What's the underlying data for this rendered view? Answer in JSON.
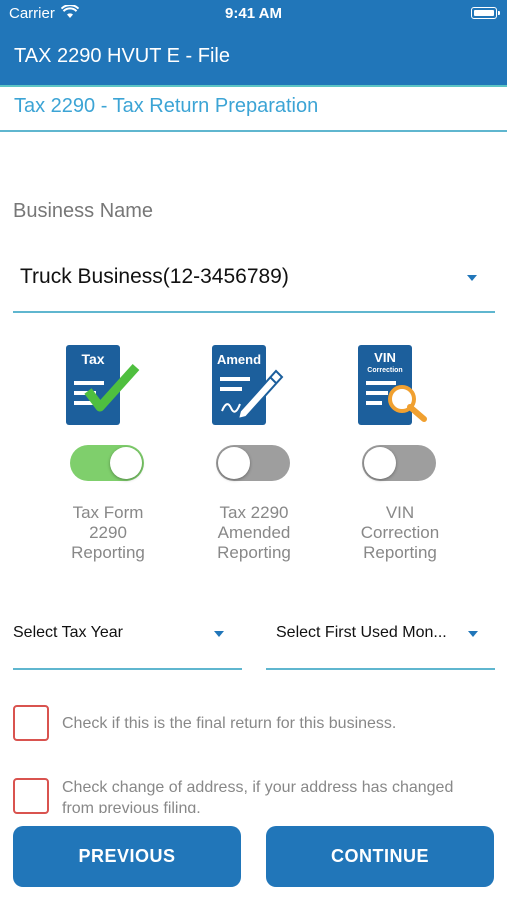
{
  "status_bar": {
    "carrier": "Carrier",
    "time": "9:41 AM"
  },
  "app_bar": {
    "title": "TAX 2290 HVUT E - File"
  },
  "sub_header": {
    "title": "Tax 2290 - Tax Return Preparation"
  },
  "business": {
    "label": "Business Name",
    "value": "Truck Business(12-3456789)"
  },
  "options": [
    {
      "icon": "tax-form-icon",
      "icon_text": "Tax",
      "toggle_on": true,
      "label_lines": [
        "Tax Form",
        "2290",
        "Reporting"
      ]
    },
    {
      "icon": "amend-icon",
      "icon_text": "Amend",
      "toggle_on": false,
      "label_lines": [
        "Tax 2290",
        "Amended",
        "Reporting"
      ]
    },
    {
      "icon": "vin-correction-icon",
      "icon_text": "VIN",
      "icon_subtext": "Correction",
      "toggle_on": false,
      "label_lines": [
        "VIN",
        "Correction",
        "Reporting"
      ]
    }
  ],
  "selects": {
    "tax_year": "Select Tax Year",
    "first_used_month": "Select First Used Mon..."
  },
  "checkboxes": [
    {
      "checked": false,
      "lines": [
        "Check if this is the final return for this business."
      ]
    },
    {
      "checked": false,
      "lines": [
        "Check change of address, if your address has changed",
        "from previous filing."
      ]
    }
  ],
  "buttons": {
    "previous": "PREVIOUS",
    "continue": "CONTINUE"
  },
  "colors": {
    "primary": "#2176b9",
    "accent": "#5fb6cf",
    "toggle_on": "#7fcf6c",
    "toggle_off": "#9e9e9e",
    "checkbox_border": "#d9534f"
  }
}
